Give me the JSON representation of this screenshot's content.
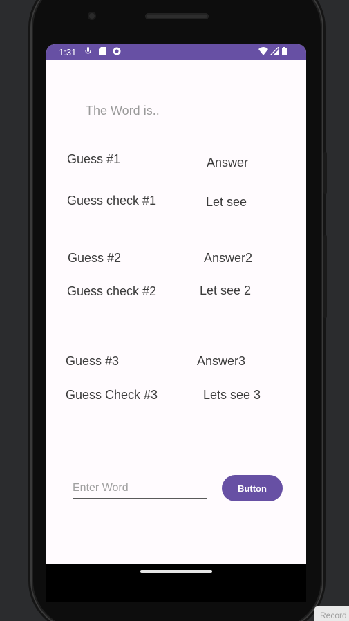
{
  "status_bar": {
    "time": "1:31",
    "left_icons": [
      "mic-icon",
      "sd-card-icon",
      "record-icon"
    ],
    "right_icons": [
      "wifi-icon",
      "signal-icon",
      "battery-icon"
    ],
    "color": "#6750a4"
  },
  "main": {
    "word_label": "The Word is..",
    "rows": [
      {
        "guess": "Guess #1",
        "answer": "Answer"
      },
      {
        "guess": "Guess check #1",
        "answer": "Let see"
      },
      {
        "guess": "Guess #2",
        "answer": "Answer2"
      },
      {
        "guess": "Guess check #2",
        "answer": "Let see 2"
      },
      {
        "guess": "Guess #3",
        "answer": "Answer3"
      },
      {
        "guess": "Guess Check #3",
        "answer": "Lets see 3"
      }
    ]
  },
  "input": {
    "value": "",
    "placeholder": "Enter Word"
  },
  "button": {
    "label": "Button",
    "color": "#6750a4"
  },
  "overlay": {
    "record_label": "Record"
  }
}
